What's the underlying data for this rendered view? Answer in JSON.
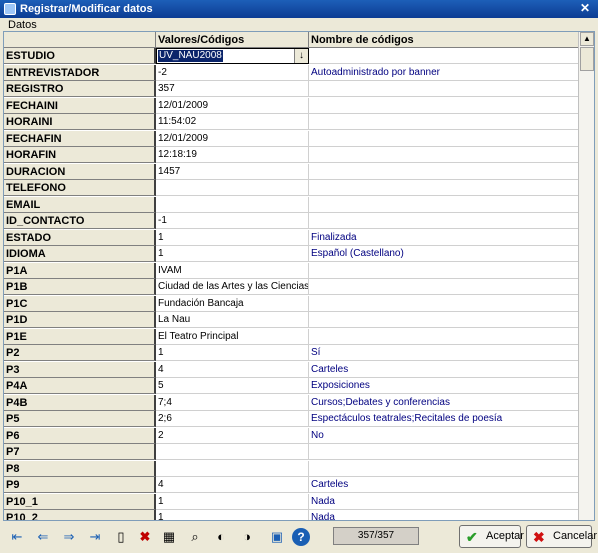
{
  "window": {
    "title": "Registrar/Modificar datos",
    "close_label": "✕"
  },
  "menu": {
    "datos": "Datos"
  },
  "grid": {
    "col_values": "Valores/Códigos",
    "col_names": "Nombre de códigos",
    "dropdown_value": "UV_NAU2008",
    "rows": [
      {
        "field": "ESTUDIO",
        "value": "",
        "name": ""
      },
      {
        "field": "ENTREVISTADOR",
        "value": "-2",
        "name": "Autoadministrado por banner"
      },
      {
        "field": "REGISTRO",
        "value": "357",
        "name": ""
      },
      {
        "field": "FECHAINI",
        "value": "12/01/2009",
        "name": ""
      },
      {
        "field": "HORAINI",
        "value": "11:54:02",
        "name": ""
      },
      {
        "field": "FECHAFIN",
        "value": "12/01/2009",
        "name": ""
      },
      {
        "field": "HORAFIN",
        "value": "12:18:19",
        "name": ""
      },
      {
        "field": "DURACION",
        "value": "1457",
        "name": ""
      },
      {
        "field": "TELEFONO",
        "value": "",
        "name": ""
      },
      {
        "field": "EMAIL",
        "value": "",
        "name": ""
      },
      {
        "field": "ID_CONTACTO",
        "value": "-1",
        "name": ""
      },
      {
        "field": "ESTADO",
        "value": "1",
        "name": "Finalizada"
      },
      {
        "field": "IDIOMA",
        "value": "1",
        "name": "Español (Castellano)"
      },
      {
        "field": "P1A",
        "value": "IVAM",
        "name": ""
      },
      {
        "field": "P1B",
        "value": "Ciudad de las Artes y las Ciencias",
        "name": ""
      },
      {
        "field": "P1C",
        "value": "Fundación Bancaja",
        "name": ""
      },
      {
        "field": "P1D",
        "value": "La Nau",
        "name": ""
      },
      {
        "field": "P1E",
        "value": "El Teatro Principal",
        "name": ""
      },
      {
        "field": "P2",
        "value": "1",
        "name": "Sí"
      },
      {
        "field": "P3",
        "value": "4",
        "name": "Carteles"
      },
      {
        "field": "P4A",
        "value": "5",
        "name": "Exposiciones"
      },
      {
        "field": "P4B",
        "value": "7;4",
        "name": "Cursos;Debates y conferencias"
      },
      {
        "field": "P5",
        "value": "2;6",
        "name": "Espectáculos teatrales;Recitales de poesía"
      },
      {
        "field": "P6",
        "value": "2",
        "name": "No"
      },
      {
        "field": "P7",
        "value": "",
        "name": ""
      },
      {
        "field": "P8",
        "value": "",
        "name": ""
      },
      {
        "field": "P9",
        "value": "4",
        "name": "Carteles"
      },
      {
        "field": "P10_1",
        "value": "1",
        "name": "Nada"
      },
      {
        "field": "P10_2",
        "value": "1",
        "name": "Nada"
      }
    ]
  },
  "toolbar": {
    "icons": [
      "first-record-icon",
      "previous-record-icon",
      "next-record-icon",
      "last-record-icon",
      "new-record-icon",
      "delete-record-icon",
      "edit-grid-icon",
      "search-icon",
      "search-previous-icon",
      "search-next-icon",
      "save-icon",
      "help-icon"
    ],
    "counter": "357/357",
    "accept_label": "Aceptar",
    "cancel_label": "Cancelar"
  }
}
